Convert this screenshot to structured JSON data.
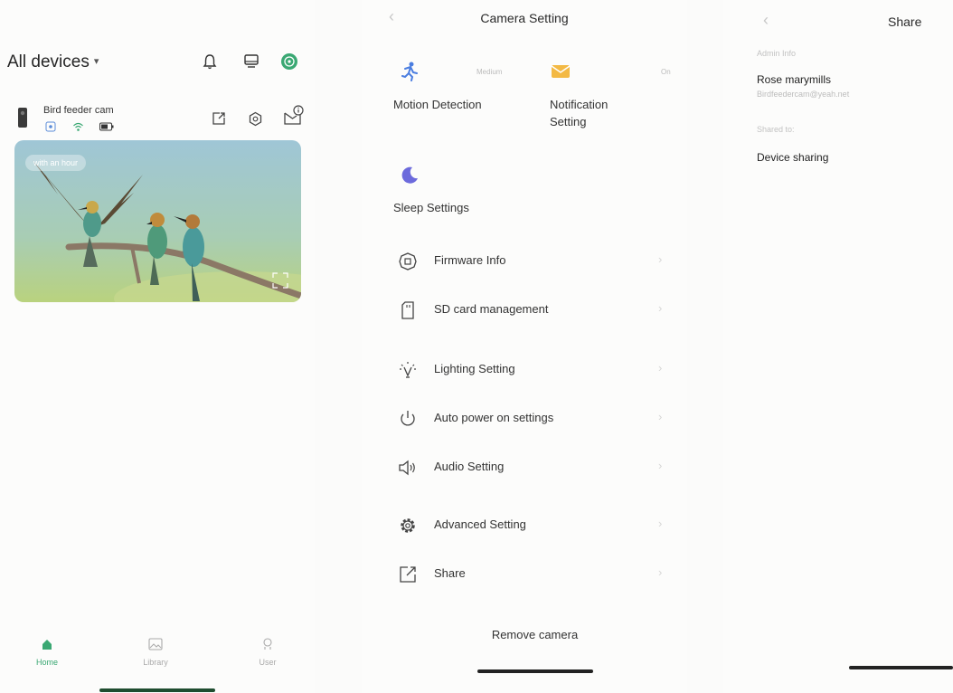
{
  "home": {
    "title": "All devices",
    "caret": "▾",
    "device": {
      "name": "Bird feeder cam",
      "badge": "with an hour"
    },
    "tabs": [
      {
        "label": "Home"
      },
      {
        "label": "Library"
      },
      {
        "label": "User"
      }
    ],
    "colors": {
      "accent": "#3aa873"
    }
  },
  "camera_setting": {
    "back": "‹",
    "title": "Camera Setting",
    "quick": [
      {
        "label": "Motion Detection",
        "value": "Medium"
      },
      {
        "label": "Notification\nSetting",
        "value": "On"
      },
      {
        "label": "Sleep Settings"
      }
    ],
    "menu": [
      {
        "label": "Firmware Info",
        "icon": "chip-icon"
      },
      {
        "label": "SD card management",
        "icon": "sd-card-icon"
      },
      {
        "label": "Lighting Setting",
        "icon": "lightbulb-icon"
      },
      {
        "label": "Auto power on settings",
        "icon": "power-icon"
      },
      {
        "label": "Audio Setting",
        "icon": "speaker-icon"
      },
      {
        "label": "Advanced Setting",
        "icon": "gear-icon"
      },
      {
        "label": "Share",
        "icon": "share-icon"
      }
    ],
    "chevron": "›",
    "remove": "Remove camera"
  },
  "share": {
    "back": "‹",
    "title": "Share",
    "admin_label": "Admin Info",
    "admin_name": "Rose marymills",
    "admin_email": "Birdfeedercam@yeah.net",
    "shared_label": "Shared to:",
    "device_sharing": "Device sharing"
  }
}
